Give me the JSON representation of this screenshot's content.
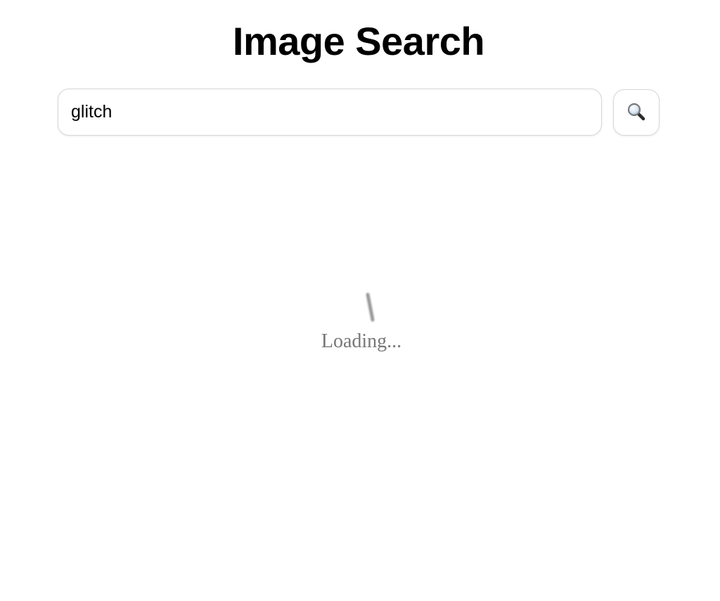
{
  "header": {
    "title": "Image Search"
  },
  "search": {
    "value": "glitch",
    "button_icon": "search-icon"
  },
  "status": {
    "loading_text": "Loading...",
    "spinner_icon": "spinner-icon"
  },
  "colors": {
    "title": "#000000",
    "border": "#d6d6d6",
    "loading_text": "#777777",
    "spinner": "#9a9a9a"
  }
}
